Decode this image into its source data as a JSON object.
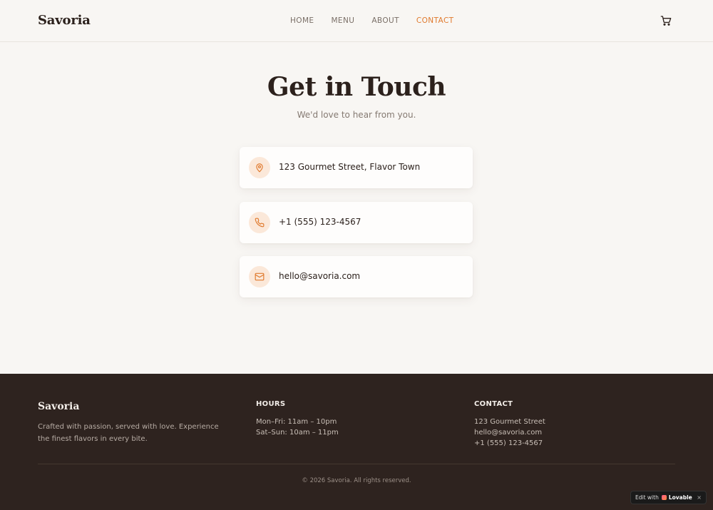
{
  "brand": "Savoria",
  "nav": {
    "home": "HOME",
    "menu": "MENU",
    "about": "ABOUT",
    "contact": "CONTACT"
  },
  "hero": {
    "title": "Get in Touch",
    "subtitle": "We'd love to hear from you."
  },
  "contact_cards": {
    "address": "123 Gourmet Street, Flavor Town",
    "phone": "+1 (555) 123-4567",
    "email": "hello@savoria.com"
  },
  "footer": {
    "brand": "Savoria",
    "description": "Crafted with passion, served with love. Experience the finest flavors in every bite.",
    "hours": {
      "heading": "HOURS",
      "line1": "Mon–Fri: 11am – 10pm",
      "line2": "Sat–Sun: 10am – 11pm"
    },
    "contact": {
      "heading": "CONTACT",
      "line1": "123 Gourmet Street",
      "line2": "hello@savoria.com",
      "line3": "+1 (555) 123-4567"
    },
    "copyright": "© 2026 Savoria. All rights reserved."
  },
  "edit_badge": {
    "prefix": "Edit with",
    "brand": "Lovable",
    "close": "×"
  },
  "colors": {
    "accent": "#e07a2e",
    "background": "#f8f6f3",
    "footer_bg": "#2e231f",
    "icon_bg": "#fbe8d9"
  },
  "icons": {
    "cart": "cart-icon",
    "address": "map-pin-icon",
    "phone": "phone-icon",
    "email": "mail-icon"
  }
}
